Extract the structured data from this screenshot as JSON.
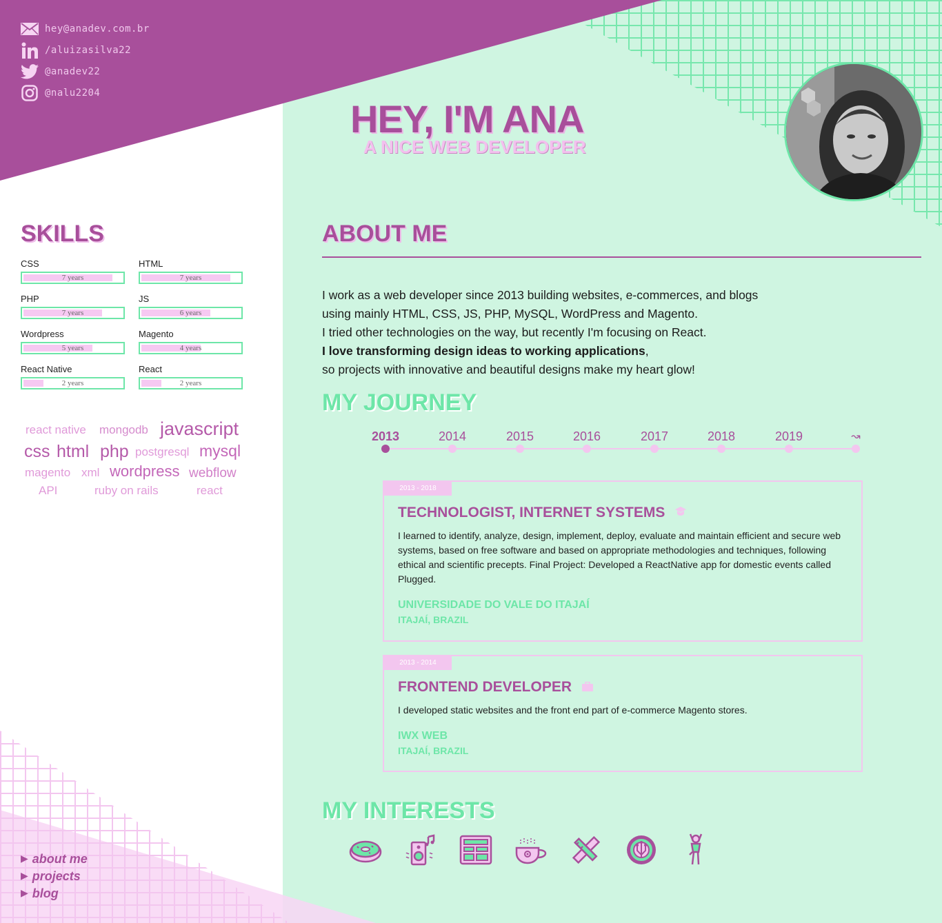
{
  "contacts": [
    {
      "icon": "mail-icon",
      "text": "hey@anadev.com.br"
    },
    {
      "icon": "linkedin-icon",
      "text": "/aluizasilva22"
    },
    {
      "icon": "twitter-icon",
      "text": "@anadev22"
    },
    {
      "icon": "instagram-icon",
      "text": "@nalu2204"
    }
  ],
  "hero": {
    "title": "HEY, I'M ANA",
    "subtitle": "A NICE WEB DEVELOPER"
  },
  "skills": {
    "heading": "SKILLS",
    "items": [
      {
        "name": "CSS",
        "label": "7 years",
        "level": 0.9
      },
      {
        "name": "HTML",
        "label": "7 years",
        "level": 0.9
      },
      {
        "name": "PHP",
        "label": "7 years",
        "level": 0.8
      },
      {
        "name": "JS",
        "label": "6 years",
        "level": 0.7
      },
      {
        "name": "Wordpress",
        "label": "5 years",
        "level": 0.7
      },
      {
        "name": "Magento",
        "label": "4 years",
        "level": 0.6
      },
      {
        "name": "React Native",
        "label": "2 years",
        "level": 0.2
      },
      {
        "name": "React",
        "label": "2 years",
        "level": 0.2
      }
    ]
  },
  "tag_cloud": [
    "react native",
    "mongodb",
    "javascript",
    "css",
    "html",
    "php",
    "postgresql",
    "mysql",
    "magento",
    "xml",
    "wordpress",
    "webflow",
    "API",
    "ruby on rails",
    "react"
  ],
  "about": {
    "heading": "ABOUT ME",
    "line1": "I work as a web developer since 2013 building websites, e-commerces, and blogs",
    "line2": "using mainly HTML, CSS, JS, PHP, MySQL, WordPress and Magento.",
    "line3": "I tried other technologies on the way, but recently I'm focusing on React.",
    "line4_bold": "I love transforming design ideas to working applications",
    "line4_rest": ",",
    "line5": "so projects with innovative and beautiful designs make my heart glow!"
  },
  "journey": {
    "heading": "MY JOURNEY",
    "years": [
      "2013",
      "2014",
      "2015",
      "2016",
      "2017",
      "2018",
      "2019",
      "↝"
    ],
    "active_year": "2013",
    "cards": [
      {
        "period": "2013 - 2018",
        "title": "TECHNOLOGIST, INTERNET SYSTEMS",
        "icon": "graduation-cap-icon",
        "description": "I learned to identify, analyze, design, implement, deploy, evaluate and maintain efficient and secure web systems, based on free software and based on appropriate methodologies and techniques, following ethical and scientific precepts. Final Project: Developed a ReactNative app for domestic events called Plugged.",
        "org": "UNIVERSIDADE DO VALE DO ITAJAÍ",
        "location": "ITAJAÍ, BRAZIL"
      },
      {
        "period": "2013 - 2014",
        "title": "FRONTEND DEVELOPER",
        "icon": "briefcase-icon",
        "description": "I developed static websites and the front end part of e-commerce Magento stores.",
        "org": "IWX WEB",
        "location": "ITAJAÍ, BRAZIL"
      }
    ]
  },
  "interests": {
    "heading": "MY INTERESTS",
    "items": [
      "donut-icon",
      "music-speaker-icon",
      "spreadsheet-icon",
      "coffee-cup-icon",
      "pencil-ruler-icon",
      "gear-circuit-icon",
      "dancer-icon"
    ]
  },
  "nav": [
    {
      "label": "about me"
    },
    {
      "label": "projects"
    },
    {
      "label": "blog"
    }
  ],
  "colors": {
    "purple": "#a84f9b",
    "mint": "#cff5e1",
    "green": "#6de6a8",
    "pink": "#f3c6ef"
  }
}
